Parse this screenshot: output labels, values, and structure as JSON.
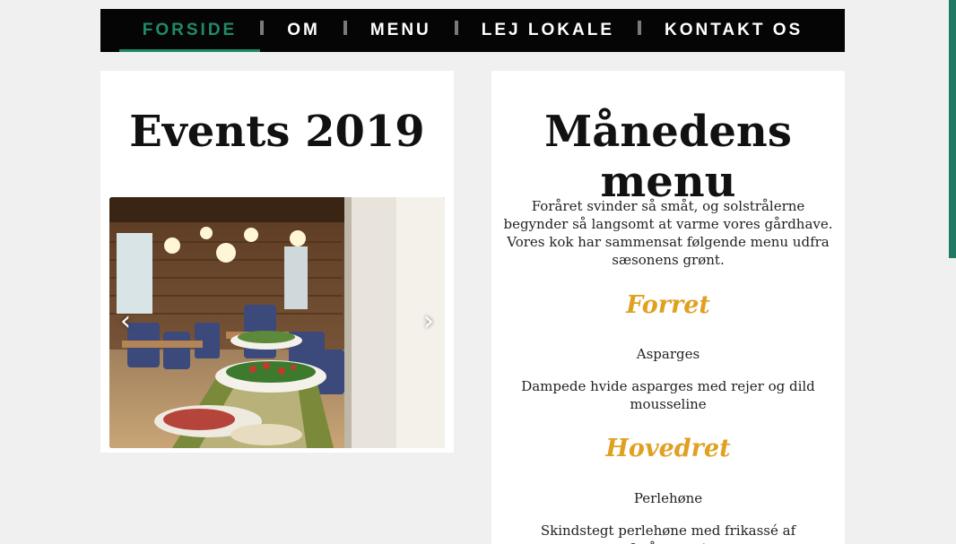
{
  "nav": {
    "items": [
      {
        "label": "FORSIDE",
        "active": true
      },
      {
        "label": "OM",
        "active": false
      },
      {
        "label": "MENU",
        "active": false
      },
      {
        "label": "LEJ LOKALE",
        "active": false
      },
      {
        "label": "KONTAKT OS",
        "active": false
      }
    ]
  },
  "events": {
    "title": "Events 2019",
    "prev_icon": "‹",
    "next_icon": "›",
    "image_icon": "restaurant-buffet-photo"
  },
  "menu": {
    "title": "Månedens menu",
    "intro": "Foråret svinder så småt, og solstrålerne begynder så langsomt at varme vores gårdhave. Vores kok har sammensat følgende menu udfra sæsonens grønt.",
    "courses": [
      {
        "heading": "Forret",
        "name": "Asparges",
        "description": "Dampede hvide asparges med rejer og dild mousseline"
      },
      {
        "heading": "Hovedret",
        "name": "Perlehøne",
        "description": "Skindstegt perlehøne med frikassé af forårsgrønt"
      }
    ]
  },
  "colors": {
    "accent": "#1f8a6b",
    "nav_bg": "#050505",
    "course_heading": "#e0a020"
  }
}
